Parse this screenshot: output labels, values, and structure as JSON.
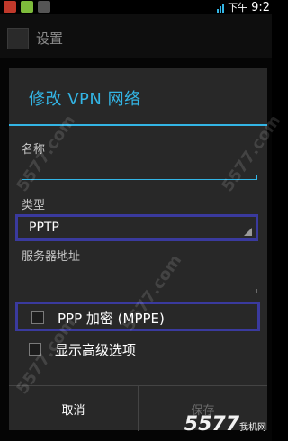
{
  "status_bar": {
    "time_prefix": "下午",
    "time": "9:2"
  },
  "action_bar": {
    "title": "设置"
  },
  "dialog": {
    "title": "修改 VPN 网络",
    "name_label": "名称",
    "name_value": "",
    "type_label": "类型",
    "type_value": "PPTP",
    "server_label": "服务器地址",
    "server_value": "",
    "encryption_label": "PPP 加密 (MPPE)",
    "encryption_checked": false,
    "advanced_label": "显示高级选项",
    "advanced_checked": false,
    "cancel_label": "取消",
    "save_label": "保存"
  },
  "watermark": {
    "text": "5577.com",
    "brand": "5577",
    "brand_sub": "我机网"
  },
  "colors": {
    "accent": "#33b5e5",
    "highlight_frame": "#3a3a9e",
    "dialog_bg": "#282828"
  }
}
